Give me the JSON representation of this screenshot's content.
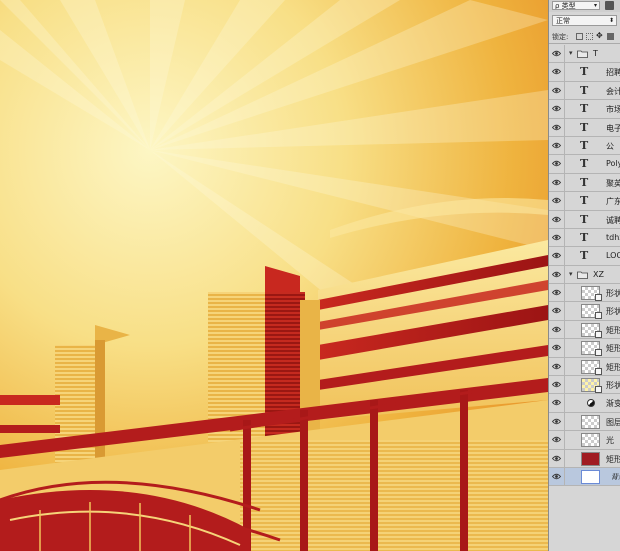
{
  "panel": {
    "filter_label": "ρ 类型",
    "blend_mode": "正常",
    "lock_label": "锁定:"
  },
  "layers": [
    {
      "kind": "group",
      "name": "T"
    },
    {
      "kind": "text",
      "name": "招聘"
    },
    {
      "kind": "text",
      "name": "会计"
    },
    {
      "kind": "text",
      "name": "市场"
    },
    {
      "kind": "text",
      "name": "电子"
    },
    {
      "kind": "text",
      "name": "公"
    },
    {
      "kind": "text",
      "name": "Poly"
    },
    {
      "kind": "text",
      "name": "聚英"
    },
    {
      "kind": "text",
      "name": "广东"
    },
    {
      "kind": "text",
      "name": "诚聘"
    },
    {
      "kind": "text",
      "name": "tdhx"
    },
    {
      "kind": "text",
      "name": "LOG"
    },
    {
      "kind": "group",
      "name": "XZ"
    },
    {
      "kind": "shape",
      "name": "形状"
    },
    {
      "kind": "shape",
      "name": "形状"
    },
    {
      "kind": "shape",
      "name": "矩形"
    },
    {
      "kind": "shape",
      "name": "矩形"
    },
    {
      "kind": "shape",
      "name": "矩形"
    },
    {
      "kind": "shape-yellow",
      "name": "形状"
    },
    {
      "kind": "adjust",
      "name": "渐变"
    },
    {
      "kind": "image",
      "name": "图层"
    },
    {
      "kind": "image",
      "name": "光"
    },
    {
      "kind": "solid-red",
      "name": "矩形"
    },
    {
      "kind": "background",
      "name": "背景"
    }
  ],
  "colors": {
    "panel_bg": "#d6d6d6",
    "selected_row": "#b9c8de",
    "sky_light": "#fdf2b6",
    "sky_orange": "#e8871c",
    "building_red": "#b31c1c"
  }
}
